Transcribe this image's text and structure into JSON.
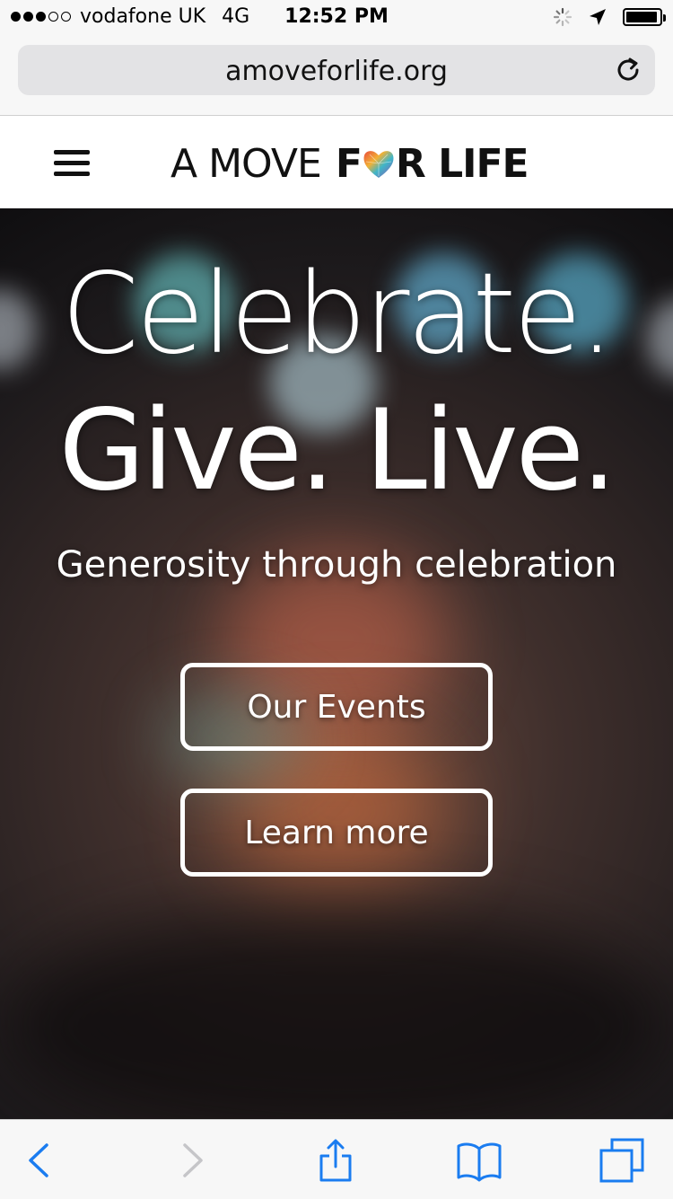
{
  "status_bar": {
    "carrier": "vodafone UK",
    "network": "4G",
    "time": "12:52 PM",
    "signal_bars_filled": 3,
    "signal_bars_total": 5,
    "battery_level": 0.9
  },
  "browser": {
    "url": "amoveforlife.org",
    "reload_icon": "reload-icon"
  },
  "site": {
    "logo": {
      "part1": "A MOVE",
      "part2_before": "F",
      "part2_after": "R LIFE",
      "heart_icon": "heart-icon"
    },
    "menu_icon": "hamburger-icon"
  },
  "hero": {
    "headline_line1": "Celebrate.",
    "headline_line2": "Give. Live.",
    "tagline": "Generosity through celebration",
    "buttons": {
      "events": "Our Events",
      "learn": "Learn more"
    }
  },
  "toolbar": {
    "icons": [
      "back-icon",
      "forward-icon",
      "share-icon",
      "bookmarks-icon",
      "tabs-icon"
    ],
    "accent": "#1a7cf0",
    "disabled": "#c5c5c8"
  }
}
